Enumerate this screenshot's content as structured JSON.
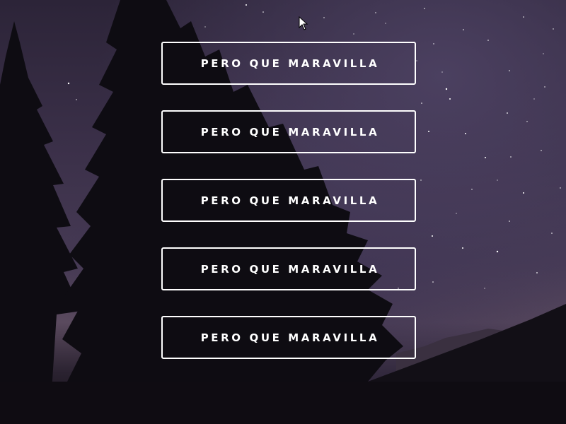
{
  "buttons": [
    {
      "label": "PERO QUE MARAVILLA"
    },
    {
      "label": "PERO QUE MARAVILLA"
    },
    {
      "label": "PERO QUE MARAVILLA"
    },
    {
      "label": "PERO QUE MARAVILLA"
    },
    {
      "label": "PERO QUE MARAVILLA"
    }
  ],
  "colors": {
    "button_border": "#ffffff",
    "button_text": "#ffffff",
    "sky_top": "#2c2438",
    "sky_mid": "#463a54",
    "silhouette": "#0e0c12"
  },
  "icons": {
    "cursor": "mouse-pointer-icon"
  }
}
